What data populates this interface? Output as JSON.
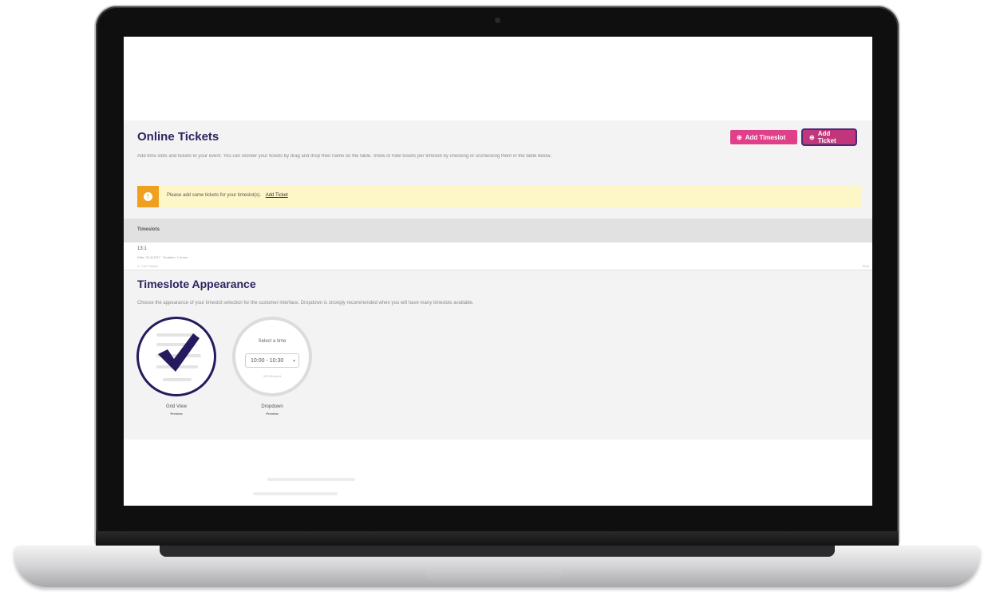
{
  "header": {
    "title": "Online Tickets",
    "add_timeslot_label": "Add Timeslot",
    "add_ticket_label": "Add Ticket",
    "description": "Add time slots and tickets to your event. You can reorder your tickets by drag and drop their name on the table. Show or hide tickets per timeslot by checking or unchecking them in the table below."
  },
  "alert": {
    "message": "Please add some tickets for your timeslot(s).",
    "link_label": "Add Ticket"
  },
  "table": {
    "header_label": "Timeslots",
    "rows": [
      {
        "name": "13:1",
        "subtitle": "Date: 31-8-2017 · Duration: 1 hours",
        "detail": "0 / 100 Tickets",
        "end": "Prev"
      }
    ]
  },
  "appearance": {
    "title": "Timeslote Appearance",
    "description": "Choose the appearance of your timeslot selection for the customer interface. Dropdown is strongly recommended when you will have many timeslots available.",
    "options": [
      {
        "label": "Grid View",
        "preview_label": "Preview",
        "selected": true
      },
      {
        "label": "Dropdown",
        "preview_label": "Preview",
        "selected": false,
        "dropdown_title": "Select a time",
        "dropdown_value": "10:00 - 10:30",
        "dropdown_sub": "30% Booked"
      }
    ]
  },
  "colors": {
    "title": "#2c2360",
    "button_primary": "#e0408a",
    "alert_bg": "#fdf7c8",
    "alert_icon": "#f0a020",
    "selected_border": "#241a5e"
  }
}
